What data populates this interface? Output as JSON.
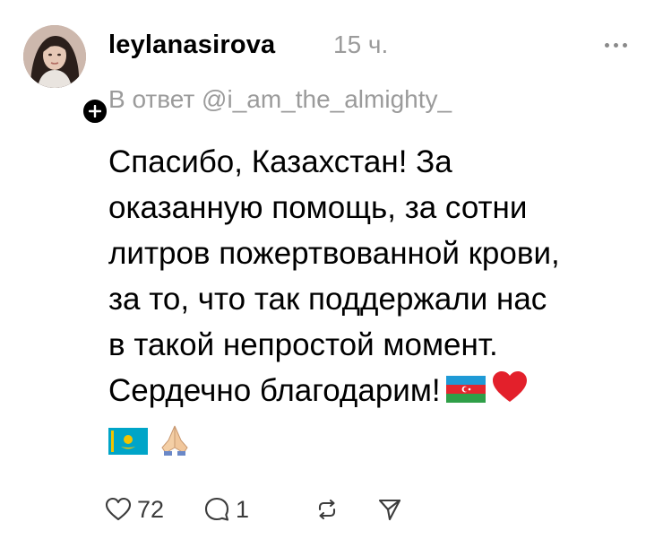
{
  "post": {
    "username": "leylanasirova",
    "time": "15 ч.",
    "reply_to": "В ответ @i_am_the_almighty_",
    "body_lines": [
      "Спасибо, Казахстан! За",
      "оказанную помощь, за сотни",
      "литров пожертвованной крови,",
      "за то, что так поддержали нас",
      "в такой непростой момент.",
      "Сердечно благодарим!"
    ],
    "emojis": {
      "line6": [
        "azerbaijan-flag",
        "red-heart"
      ],
      "line7": [
        "kazakhstan-flag",
        "folded-hands"
      ]
    }
  },
  "actions": {
    "likes": "72",
    "comments": "1"
  },
  "icons": {
    "more": "more-horizontal-icon",
    "like": "heart-outline-icon",
    "comment": "comment-bubble-icon",
    "repost": "repost-icon",
    "share": "send-icon",
    "follow": "plus-icon"
  },
  "colors": {
    "text": "#000000",
    "muted": "#9b9b9b",
    "icon": "#3c3c3c",
    "heart": "#e3202b"
  }
}
